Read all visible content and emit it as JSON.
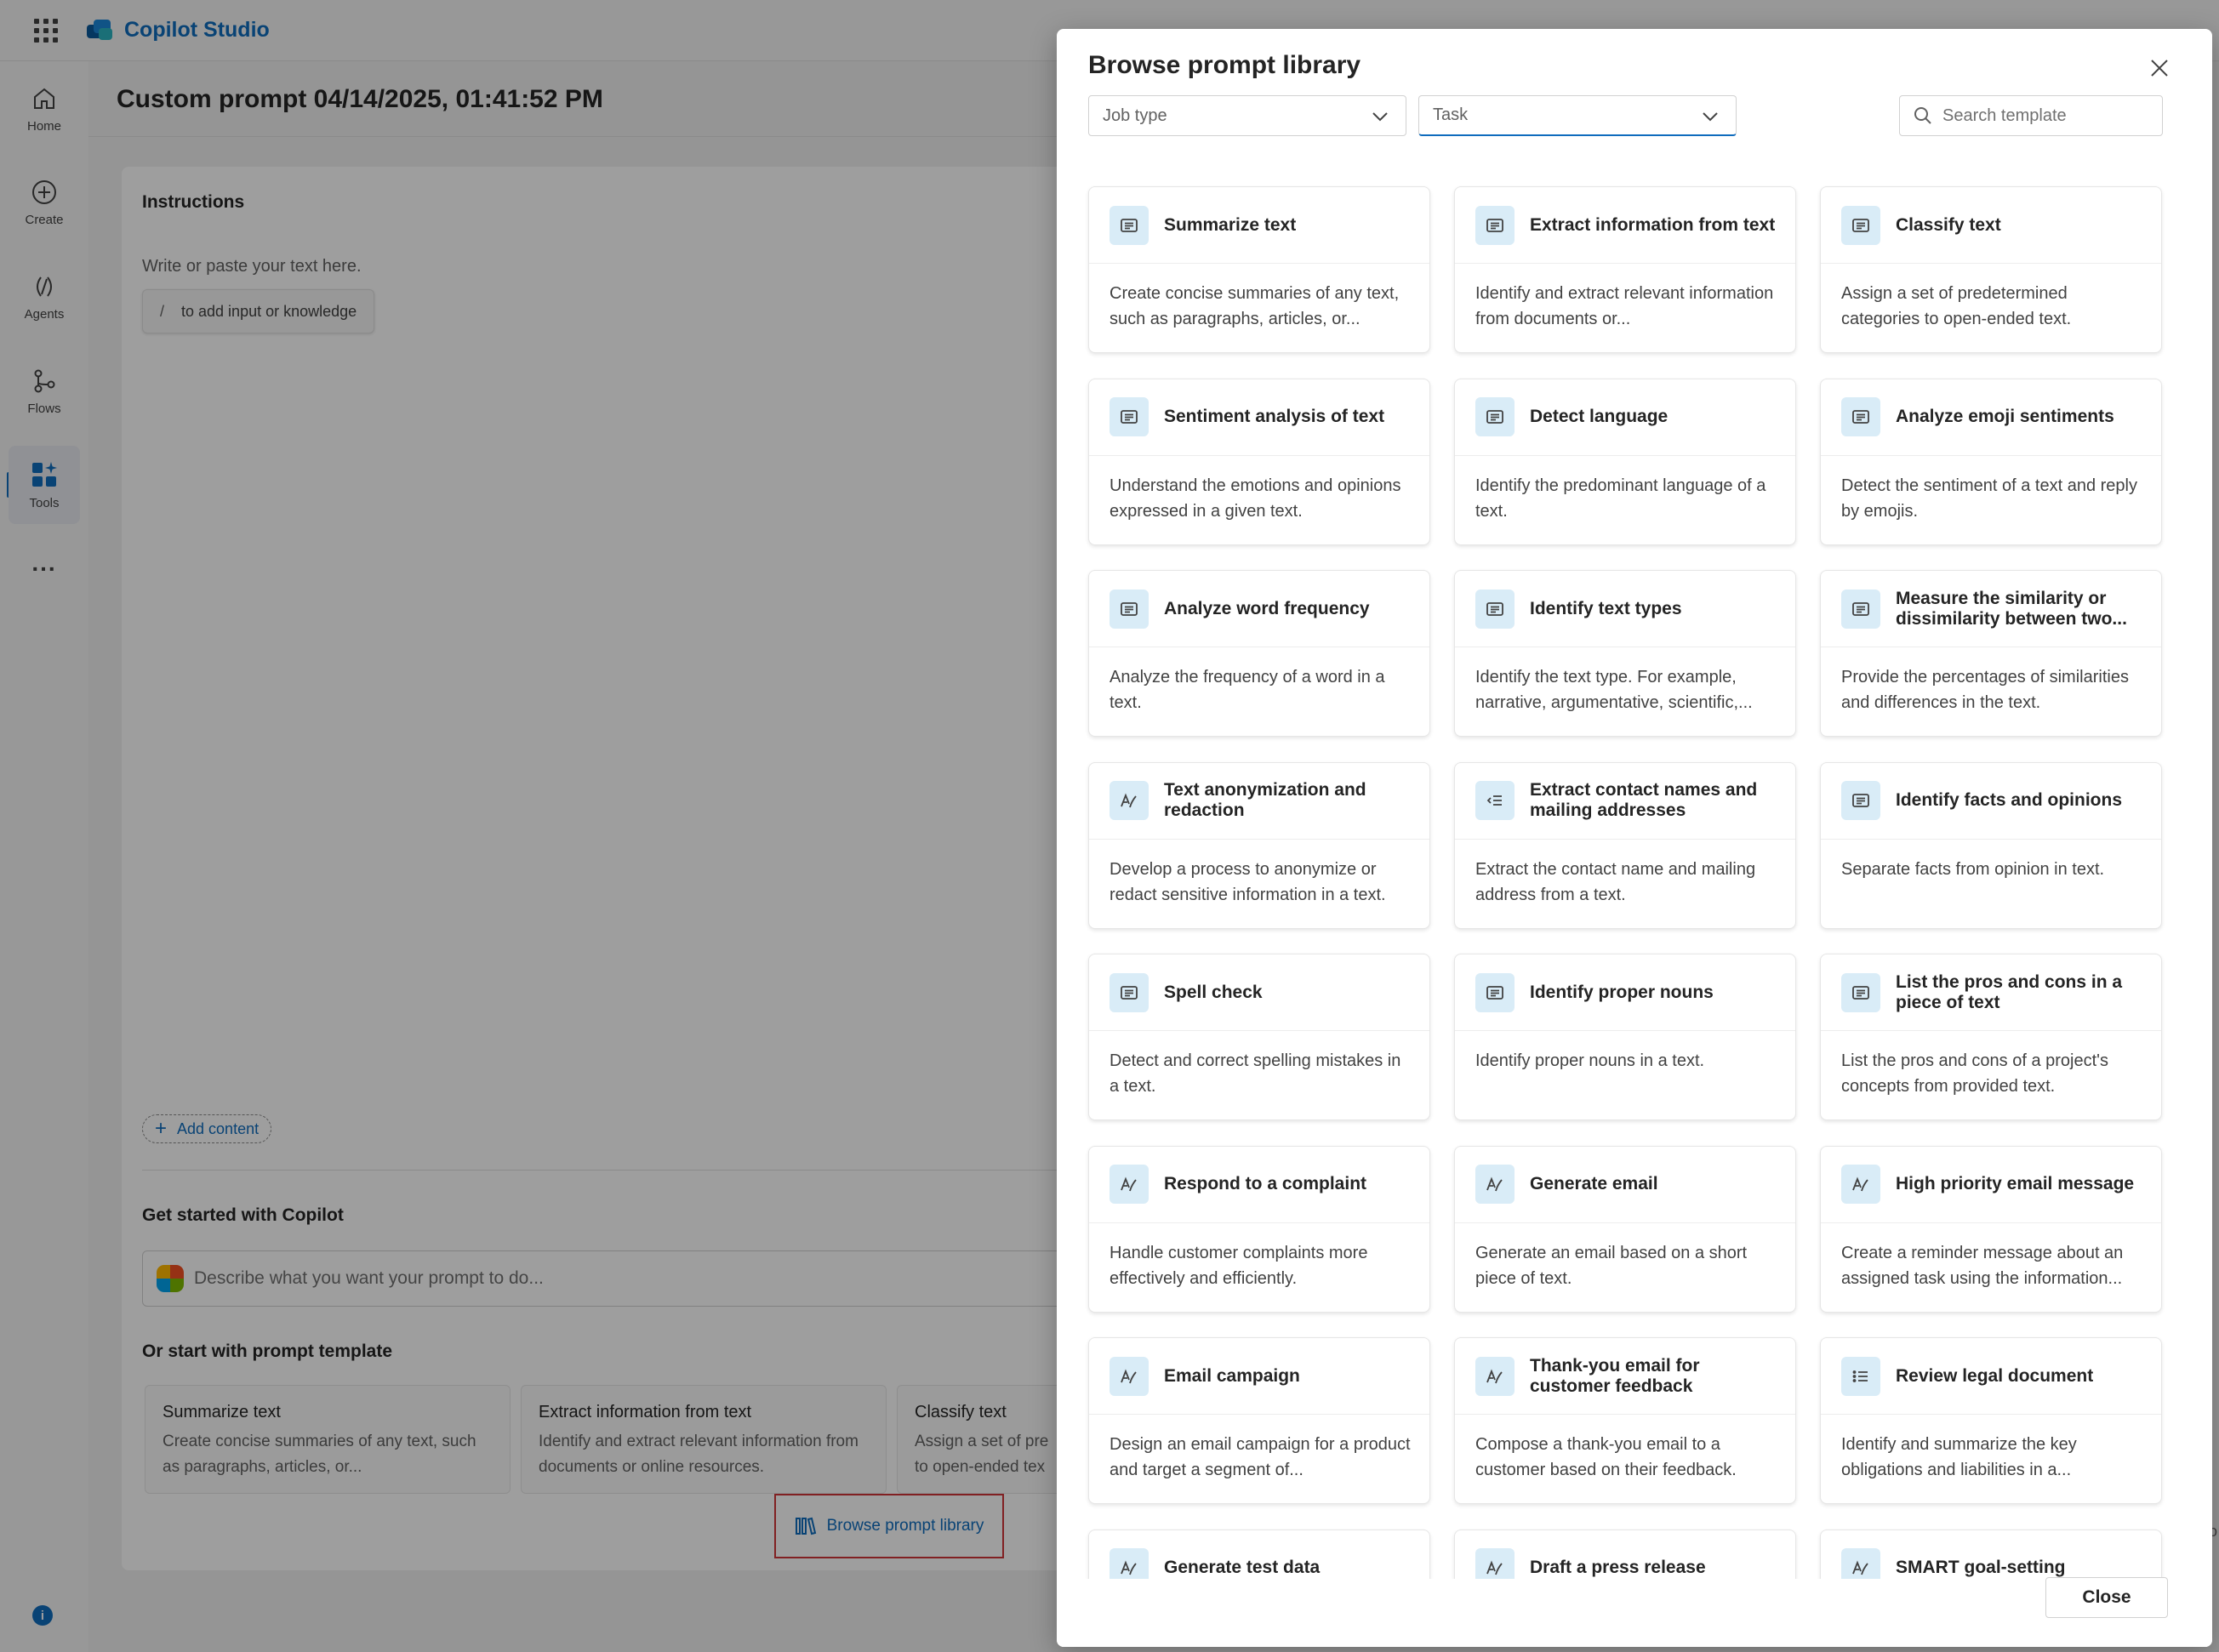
{
  "app": {
    "title": "Copilot Studio"
  },
  "rail": {
    "items": [
      {
        "label": "Home",
        "icon": "home-icon"
      },
      {
        "label": "Create",
        "icon": "plus-circle-icon"
      },
      {
        "label": "Agents",
        "icon": "agents-icon"
      },
      {
        "label": "Flows",
        "icon": "flow-icon"
      },
      {
        "label": "Tools",
        "icon": "tools-icon"
      }
    ],
    "more": "..."
  },
  "page": {
    "title": "Custom prompt 04/14/2025, 01:41:52 PM",
    "instructions_label": "Instructions",
    "instructions_placeholder": "Write or paste your text here.",
    "slash_key": "/",
    "slash_hint": "to add input or knowledge",
    "add_content": "Add content",
    "get_started": "Get started with Copilot",
    "copilot_placeholder": "Describe what you want your prompt to do...",
    "template_heading": "Or start with prompt template",
    "templates": [
      {
        "title": "Summarize text",
        "desc": "Create concise summaries of any text, such as paragraphs, articles, or..."
      },
      {
        "title": "Extract information from text",
        "desc": "Identify and extract relevant information from documents or online resources."
      },
      {
        "title": "Classify text",
        "desc": "Assign a set of pre to open-ended tex"
      }
    ],
    "browse_library": "Browse prompt library",
    "edge_text": "ro"
  },
  "dialog": {
    "title": "Browse prompt library",
    "job_type": "Job type",
    "task": "Task",
    "search_placeholder": "Search template",
    "close_label": "Close",
    "cards": [
      {
        "title": "Summarize text",
        "desc": "Create concise summaries of any text, such as paragraphs, articles, or...",
        "icon": "text-doc-icon"
      },
      {
        "title": "Extract information from text",
        "desc": "Identify and extract relevant information from documents or...",
        "icon": "text-doc-icon"
      },
      {
        "title": "Classify text",
        "desc": "Assign a set of predetermined categories to open-ended text.",
        "icon": "text-doc-icon"
      },
      {
        "title": "Sentiment analysis of text",
        "desc": "Understand the emotions and opinions expressed in a given text.",
        "icon": "text-doc-icon"
      },
      {
        "title": "Detect language",
        "desc": "Identify the predominant language of a text.",
        "icon": "text-doc-icon"
      },
      {
        "title": "Analyze emoji sentiments",
        "desc": "Detect the sentiment of a text and reply by emojis.",
        "icon": "text-doc-icon"
      },
      {
        "title": "Analyze word frequency",
        "desc": "Analyze the frequency of a word in a text.",
        "icon": "text-doc-icon"
      },
      {
        "title": "Identify text types",
        "desc": "Identify the text type. For example, narrative, argumentative, scientific,...",
        "icon": "text-doc-icon"
      },
      {
        "title": "Measure the similarity or dissimilarity between two...",
        "desc": "Provide the percentages of similarities and differences in the text.",
        "icon": "text-doc-icon"
      },
      {
        "title": "Text anonymization and redaction",
        "desc": "Develop a process to anonymize or redact sensitive information in a text.",
        "icon": "pen-icon"
      },
      {
        "title": "Extract contact names and mailing addresses",
        "desc": "Extract the contact name and mailing address from a text.",
        "icon": "extract-list-icon"
      },
      {
        "title": "Identify facts and opinions",
        "desc": "Separate facts from opinion in text.",
        "icon": "text-doc-icon"
      },
      {
        "title": "Spell check",
        "desc": "Detect and correct spelling mistakes in a text.",
        "icon": "text-doc-icon"
      },
      {
        "title": "Identify proper nouns",
        "desc": "Identify proper nouns in a text.",
        "icon": "text-doc-icon"
      },
      {
        "title": "List the pros and cons in a piece of text",
        "desc": "List the pros and cons of a project's concepts from provided text.",
        "icon": "text-doc-icon"
      },
      {
        "title": "Respond to a complaint",
        "desc": "Handle customer complaints more effectively and efficiently.",
        "icon": "pen-icon"
      },
      {
        "title": "Generate email",
        "desc": "Generate an email based on a short piece of text.",
        "icon": "pen-icon"
      },
      {
        "title": "High priority email message",
        "desc": "Create a reminder message about an assigned task using the information...",
        "icon": "pen-icon"
      },
      {
        "title": "Email campaign",
        "desc": "Design an email campaign for a product and target a segment of...",
        "icon": "pen-icon"
      },
      {
        "title": "Thank-you email for customer feedback",
        "desc": "Compose a thank-you email to a customer based on their feedback.",
        "icon": "pen-icon"
      },
      {
        "title": "Review legal document",
        "desc": "Identify and summarize the key obligations and liabilities in a...",
        "icon": "list-icon"
      },
      {
        "title": "Generate test data",
        "desc": "",
        "icon": "pen-icon"
      },
      {
        "title": "Draft a press release",
        "desc": "",
        "icon": "pen-icon"
      },
      {
        "title": "SMART goal-setting",
        "desc": "",
        "icon": "pen-icon"
      }
    ]
  },
  "colors": {
    "accent": "#0f6cbd",
    "icon_bg": "#d9ecf7",
    "highlight": "#d13438"
  }
}
